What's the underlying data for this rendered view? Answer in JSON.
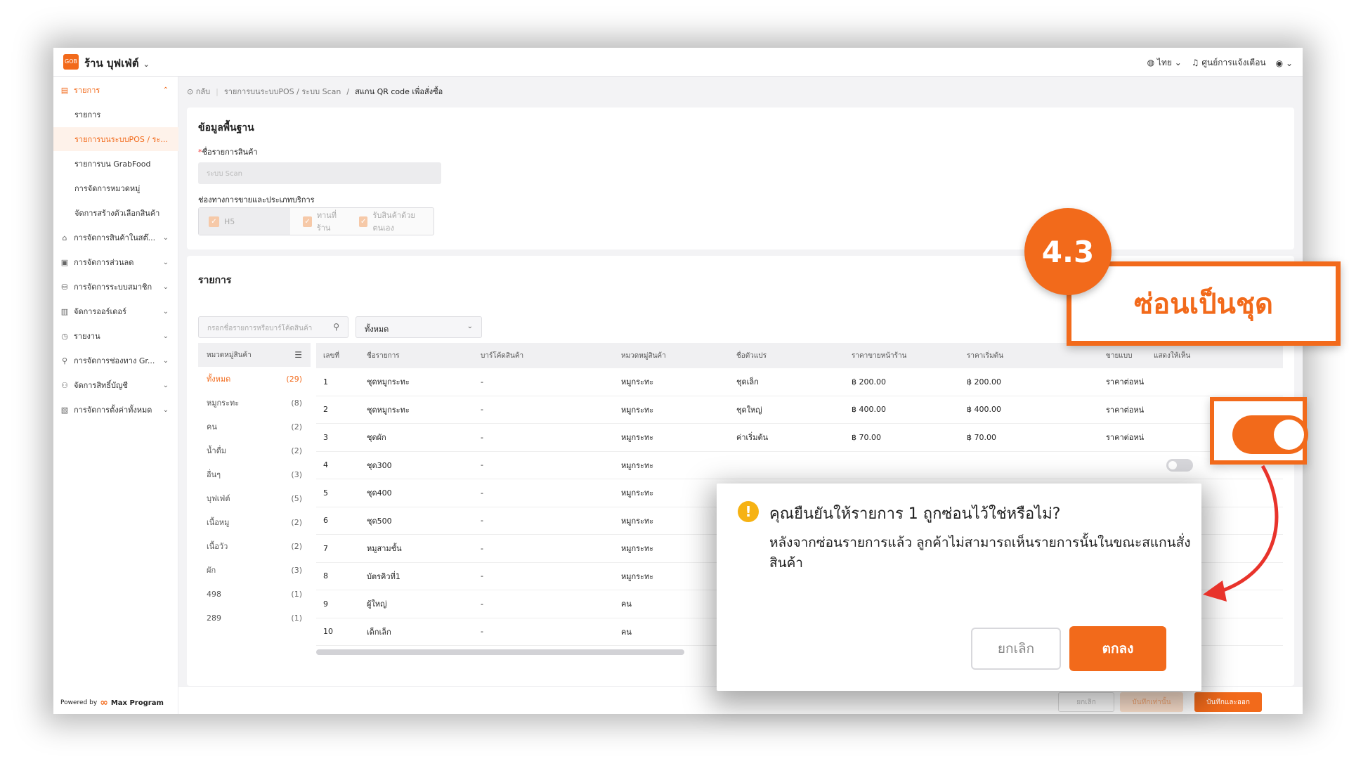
{
  "header": {
    "logo_text": "GOB",
    "shop_name": "ร้าน บุฟเฟ่ต์",
    "language": "ไทย",
    "notifications": "ศูนย์การแจ้งเตือน"
  },
  "sidebar": {
    "items": [
      {
        "label": "รายการ",
        "icon": "list-icon"
      },
      {
        "label": "รายการ"
      },
      {
        "label": "รายการบนระบบPOS / ระ..."
      },
      {
        "label": "รายการบน GrabFood"
      },
      {
        "label": "การจัดการหมวดหมู่"
      },
      {
        "label": "จัดการสร้างตัวเลือกสินค้า"
      },
      {
        "label": "การจัดการสินค้าในสต๊...",
        "icon": "store-icon"
      },
      {
        "label": "การจัดการส่วนลด",
        "icon": "discount-icon"
      },
      {
        "label": "การจัดการระบบสมาชิก",
        "icon": "member-icon"
      },
      {
        "label": "จัดการออร์เดอร์",
        "icon": "order-icon"
      },
      {
        "label": "รายงาน",
        "icon": "report-icon"
      },
      {
        "label": "การจัดการช่องทาง Gr...",
        "icon": "channel-icon"
      },
      {
        "label": "จัดการสิทธิ์บัญชี",
        "icon": "account-icon"
      },
      {
        "label": "การจัดการตั้งค่าทั้งหมด",
        "icon": "settings-icon"
      }
    ],
    "powered_by": "Powered by",
    "brand": "Max Program"
  },
  "breadcrumb": {
    "back": "กลับ",
    "path1": "รายการบนระบบPOS / ระบบ Scan",
    "current": "สแกน QR code เพื่อสั่งซื้อ"
  },
  "basic": {
    "title": "ข้อมูลพื้นฐาน",
    "name_label": "ชื่อรายการสินค้า",
    "name_value": "ระบบ Scan",
    "channels_label": "ช่องทางการขายและประเภทบริการ",
    "channels": [
      "H5",
      "ทานที่ร้าน",
      "รับสินค้าด้วยตนเอง"
    ]
  },
  "items_section": {
    "title": "รายการ",
    "search_placeholder": "กรอกชื่อรายการหรือบาร์โค้ดสินค้า",
    "filter_value": "ทั้งหมด",
    "category_header": "หมวดหมู่สินค้า",
    "categories": [
      {
        "name": "ทั้งหมด",
        "count": "(29)"
      },
      {
        "name": "หมูกระทะ",
        "count": "(8)"
      },
      {
        "name": "คน",
        "count": "(2)"
      },
      {
        "name": "น้ำดื่ม",
        "count": "(2)"
      },
      {
        "name": "อื่นๆ",
        "count": "(3)"
      },
      {
        "name": "บุฟเฟ่ต์",
        "count": "(5)"
      },
      {
        "name": "เนื้อหมู",
        "count": "(2)"
      },
      {
        "name": "เนื้อวัว",
        "count": "(2)"
      },
      {
        "name": "ผัก",
        "count": "(3)"
      },
      {
        "name": "498",
        "count": "(1)"
      },
      {
        "name": "289",
        "count": "(1)"
      }
    ],
    "columns": [
      "เลขที่",
      "ชื่อรายการ",
      "บาร์โค้ดสินค้า",
      "หมวดหมู่สินค้า",
      "ชื่อตัวแปร",
      "ราคาขายหน้าร้าน",
      "ราคาเริ่มต้น",
      "ขายแบบ",
      "แสดงให้เห็น"
    ],
    "rows": [
      {
        "no": "1",
        "name": "ชุดหมูกระทะ",
        "barcode": "-",
        "category": "หมูกระทะ",
        "variant": "ชุดเล็ก",
        "price": "฿ 200.00",
        "start": "฿ 200.00",
        "sell": "ราคาต่อหน่"
      },
      {
        "no": "2",
        "name": "ชุดหมูกระทะ",
        "barcode": "-",
        "category": "หมูกระทะ",
        "variant": "ชุดใหญ่",
        "price": "฿ 400.00",
        "start": "฿ 400.00",
        "sell": "ราคาต่อหน่"
      },
      {
        "no": "3",
        "name": "ชุดผัก",
        "barcode": "-",
        "category": "หมูกระทะ",
        "variant": "ค่าเริ่มต้น",
        "price": "฿ 70.00",
        "start": "฿ 70.00",
        "sell": "ราคาต่อหน่"
      },
      {
        "no": "4",
        "name": "ชุด300",
        "barcode": "-",
        "category": "หมูกระทะ",
        "variant": "",
        "price": "",
        "start": "",
        "sell": ""
      },
      {
        "no": "5",
        "name": "ชุด400",
        "barcode": "-",
        "category": "หมูกระทะ",
        "variant": "",
        "price": "",
        "start": "",
        "sell": ""
      },
      {
        "no": "6",
        "name": "ชุด500",
        "barcode": "-",
        "category": "หมูกระทะ",
        "variant": "",
        "price": "",
        "start": "",
        "sell": ""
      },
      {
        "no": "7",
        "name": "หมูสามชั้น",
        "barcode": "-",
        "category": "หมูกระทะ",
        "variant": "",
        "price": "",
        "start": "",
        "sell": ""
      },
      {
        "no": "8",
        "name": "บัตรคิวที่1",
        "barcode": "-",
        "category": "หมูกระทะ",
        "variant": "",
        "price": "",
        "start": "",
        "sell": ""
      },
      {
        "no": "9",
        "name": "ผู้ใหญ่",
        "barcode": "-",
        "category": "คน",
        "variant": "",
        "price": "",
        "start": "",
        "sell": ""
      },
      {
        "no": "10",
        "name": "เด็กเล็ก",
        "barcode": "-",
        "category": "คน",
        "variant": "",
        "price": "",
        "start": "",
        "sell": ""
      }
    ]
  },
  "footer": {
    "cancel": "ยกเลิก",
    "save": "บันทึกเท่านั้น",
    "save_exit": "บันทึกและออก"
  },
  "dialog": {
    "title": "คุณยืนยันให้รายการ 1 ถูกซ่อนไว้ใช่หรือไม่?",
    "body": "หลังจากซ่อนรายการแล้ว ลูกค้าไม่สามารถเห็นรายการนั้นในขณะสแกนสั่งสินค้า",
    "cancel": "ยกเลิก",
    "ok": "ตกลง"
  },
  "annotation": {
    "step": "4.3",
    "label": "ซ่อนเป็นชุด"
  },
  "colors": {
    "accent": "#f26a1b",
    "warning": "#f6b213",
    "arrow": "#e8332b"
  }
}
